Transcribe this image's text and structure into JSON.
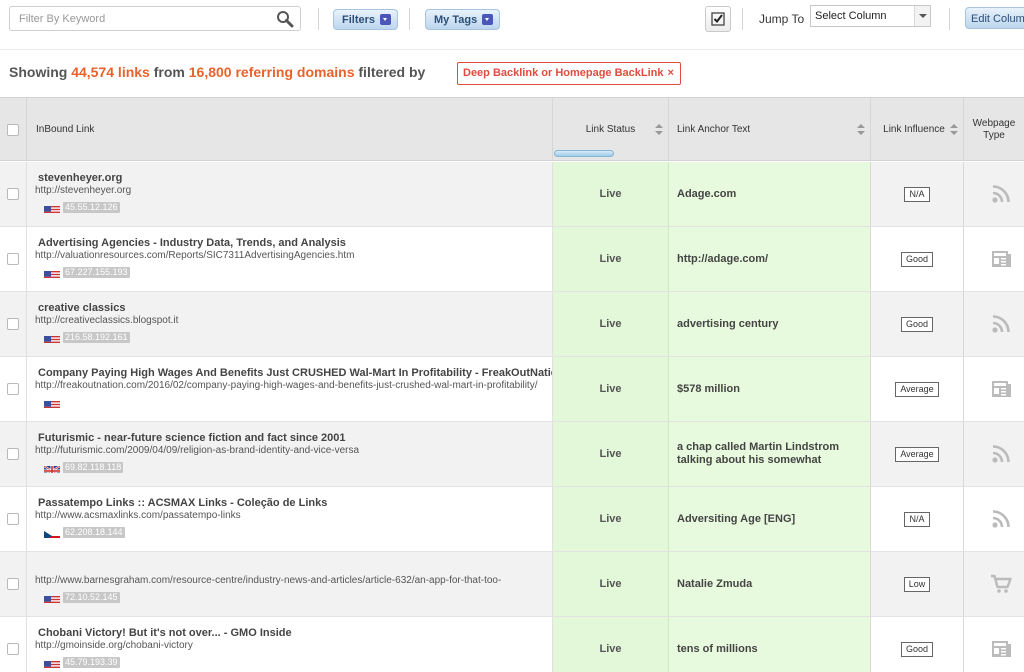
{
  "toolbar": {
    "search_placeholder": "Filter By Keyword",
    "filters_label": "Filters",
    "mytags_label": "My Tags",
    "jump_to_label": "Jump To",
    "jump_select_value": "Select Column",
    "edit_columns_label": "Edit Columns"
  },
  "summary": {
    "showing": "Showing",
    "links_count": "44,574 links",
    "from": "from",
    "domains_count": "16,800 referring domains",
    "filtered_by": "filtered by",
    "filter_tag": "Deep Backlink or Homepage BackLink",
    "filter_tag_x": "×"
  },
  "table": {
    "columns": {
      "inbound": "InBound Link",
      "status": "Link Status",
      "anchor": "Link Anchor Text",
      "influence": "Link Influence",
      "webpage_type_line1": "Webpage",
      "webpage_type_line2": "Type"
    },
    "rows": [
      {
        "title": "stevenheyer.org",
        "url": "http://stevenheyer.org",
        "flag": "us",
        "ip": "45.55.12.126",
        "status": "Live",
        "anchor": "Adage.com",
        "influence": "N/A",
        "type": "rss"
      },
      {
        "title": "Advertising Agencies - Industry Data, Trends, and Analysis",
        "url": "http://valuationresources.com/Reports/SIC7311AdvertisingAgencies.htm",
        "flag": "us",
        "ip": "67.227.155.193",
        "status": "Live",
        "anchor": "http://adage.com/",
        "influence": "Good",
        "type": "news"
      },
      {
        "title": "creative classics",
        "url": "http://creativeclassics.blogspot.it",
        "flag": "us",
        "ip": "216.58.192.161",
        "status": "Live",
        "anchor": "advertising century",
        "influence": "Good",
        "type": "rss"
      },
      {
        "title": "Company Paying High Wages And Benefits Just CRUSHED Wal-Mart In Profitability - FreakOutNation",
        "url": "http://freakoutnation.com/2016/02/company-paying-high-wages-and-benefits-just-crushed-wal-mart-in-profitability/",
        "flag": "us",
        "ip": "",
        "status": "Live",
        "anchor": "$578 million",
        "influence": "Average",
        "type": "news"
      },
      {
        "title": "Futurismic - near-future science fiction and fact since 2001",
        "url": "http://futurismic.com/2009/04/09/religion-as-brand-identity-and-vice-versa",
        "flag": "uk",
        "ip": "69.82.118.118",
        "status": "Live",
        "anchor": "a chap called Martin Lindstrom talking about his somewhat",
        "influence": "Average",
        "type": "rss"
      },
      {
        "title": "Passatempo Links :: ACSMAX Links - Coleção de Links",
        "url": "http://www.acsmaxlinks.com/passatempo-links",
        "flag": "cz",
        "ip": "62.208.18.144",
        "status": "Live",
        "anchor": "Adversiting Age [ENG]",
        "influence": "N/A",
        "type": "rss"
      },
      {
        "title": "",
        "url": "http://www.barnesgraham.com/resource-centre/industry-news-and-articles/article-632/an-app-for-that-too-",
        "flag": "us",
        "ip": "72.10.52.145",
        "status": "Live",
        "anchor": "Natalie Zmuda",
        "influence": "Low",
        "type": "cart"
      },
      {
        "title": "Chobani Victory! But it's not over... - GMO Inside",
        "url": "http://gmoinside.org/chobani-victory",
        "flag": "us",
        "ip": "45.79.193.39",
        "status": "Live",
        "anchor": "tens of millions",
        "influence": "Good",
        "type": "news"
      }
    ]
  }
}
